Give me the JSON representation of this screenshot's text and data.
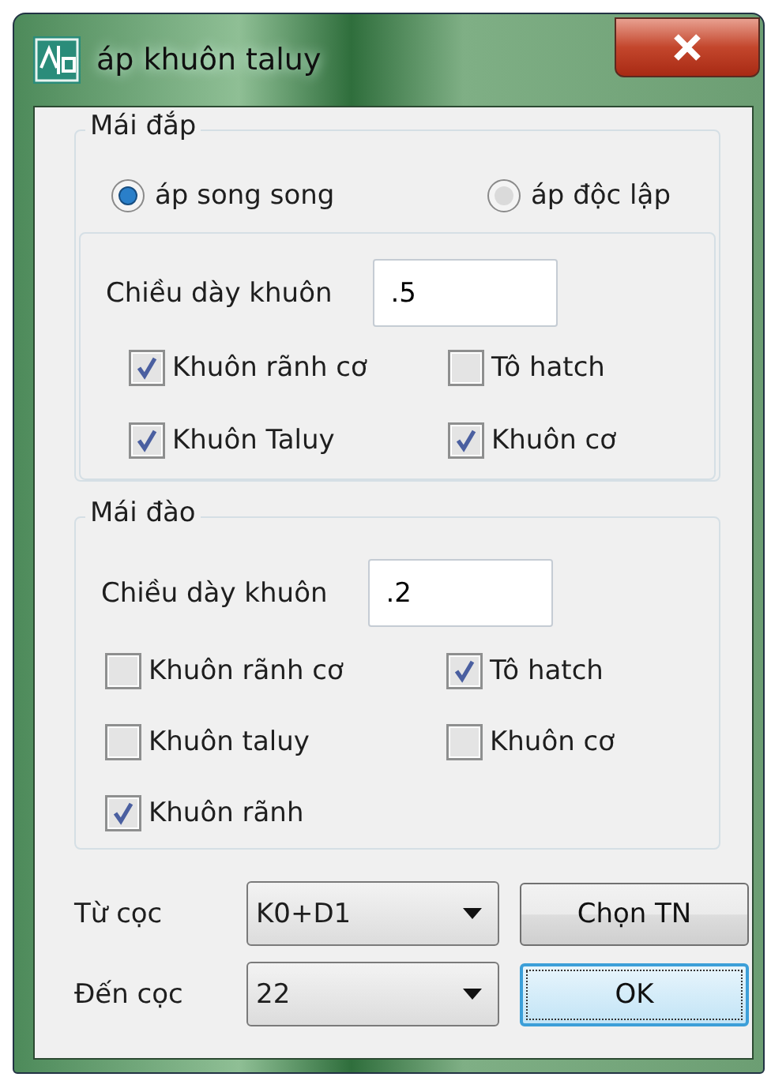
{
  "window": {
    "title": "áp khuôn taluy"
  },
  "mai_dap": {
    "title": "Mái đắp",
    "radios": [
      {
        "label": "áp song song",
        "selected": true
      },
      {
        "label": "áp độc lập",
        "selected": false
      }
    ],
    "thickness": {
      "label": "Chiều dày khuôn",
      "value": ".5"
    },
    "checkboxes": [
      {
        "label": "Khuôn rãnh cơ",
        "checked": true
      },
      {
        "label": "Tô hatch",
        "checked": false
      },
      {
        "label": "Khuôn Taluy",
        "checked": true
      },
      {
        "label": "Khuôn cơ",
        "checked": true
      }
    ]
  },
  "mai_dao": {
    "title": "Mái đào",
    "thickness": {
      "label": "Chiều dày khuôn",
      "value": ".2"
    },
    "checkboxes": [
      {
        "label": "Khuôn rãnh cơ",
        "checked": false
      },
      {
        "label": "Tô hatch",
        "checked": true
      },
      {
        "label": "Khuôn taluy",
        "checked": false
      },
      {
        "label": "Khuôn cơ",
        "checked": false
      },
      {
        "label": "Khuôn rãnh",
        "checked": true
      }
    ]
  },
  "tu_coc": {
    "label": "Từ cọc",
    "value": "K0+D1"
  },
  "den_coc": {
    "label": "Đến cọc",
    "value": "22"
  },
  "buttons": [
    {
      "label": "Chọn TN",
      "focused": false
    },
    {
      "label": "OK",
      "focused": true
    }
  ]
}
